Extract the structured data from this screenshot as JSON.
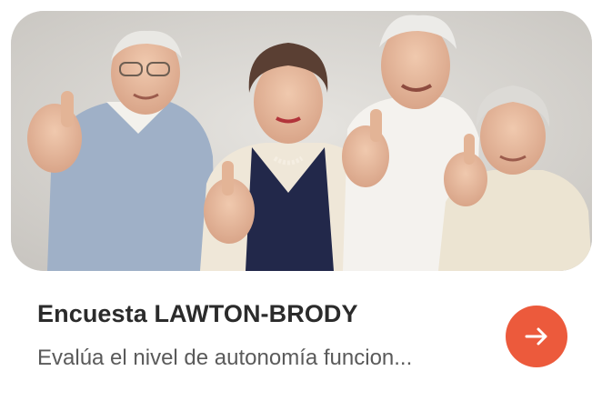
{
  "card": {
    "image_alt": "photo of four smiling seniors giving thumbs up",
    "title": "Encuesta LAWTON-BRODY",
    "description": "Evalúa el nivel de autonomía funcion...",
    "action_icon": "arrow-right-icon",
    "accent_color": "#ec5a3c"
  }
}
